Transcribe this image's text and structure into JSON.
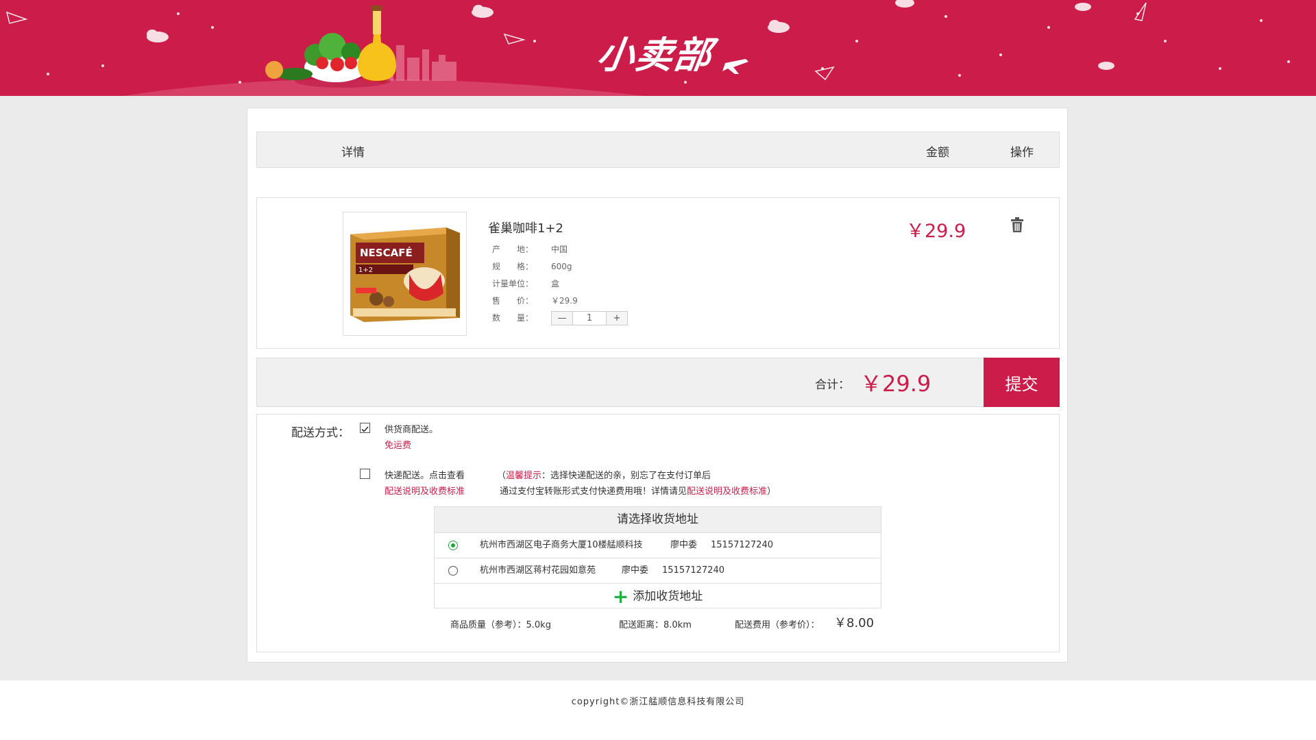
{
  "header": {
    "logo_text": "小卖部"
  },
  "table_header": {
    "detail": "详情",
    "amount": "金额",
    "action": "操作"
  },
  "product": {
    "name": "雀巢咖啡1+2",
    "image_alt": "NESCAFÉ 雀巢咖啡 1+2",
    "attrs": [
      {
        "key": "产　　地：",
        "value": "中国"
      },
      {
        "key": "规　　格：",
        "value": "600g"
      },
      {
        "key": "计量单位：",
        "value": "盒"
      },
      {
        "key": "售　　价：",
        "value": "￥29.9"
      },
      {
        "key": "数　　量："
      }
    ],
    "qty": "1",
    "minus": "—",
    "plus": "+",
    "price": "￥29.9"
  },
  "total": {
    "label": "合计：",
    "value": "￥29.9",
    "submit": "提交"
  },
  "delivery": {
    "label": "配送方式：",
    "option1": {
      "text": "供货商配送。",
      "sub": "免运费",
      "checked": true
    },
    "option2": {
      "text": "快递配送。点击查看",
      "link": "配送说明及收费标准",
      "checked": false
    },
    "tip": {
      "open": "（",
      "tip_label": "温馨提示",
      "line1": "：选择快递配送的亲，别忘了在支付订单后",
      "line2": "通过支付宝转账形式支付快递费用哦！详情请见",
      "link": "配送说明及收费标准",
      "close": "）"
    }
  },
  "address": {
    "title": "请选择收货地址",
    "rows": [
      {
        "addr": "杭州市西湖区电子商务大厦10楼艋顺科技",
        "name": "廖中委",
        "phone": "15157127240",
        "selected": true
      },
      {
        "addr": "杭州市西湖区蒋村花园如意苑",
        "name": "廖中委",
        "phone": "15157127240",
        "selected": false
      }
    ],
    "add_label": "添加收货地址"
  },
  "summary": {
    "weight": "商品质量（参考）：5.0kg",
    "distance": "配送距离：8.0km",
    "fee_label": "配送费用（参考价）：",
    "fee_value": "￥8.00"
  },
  "footer": {
    "copyright": "copyright©浙江艋顺信息科技有限公司"
  },
  "colors": {
    "brand": "#cb1c4a",
    "accent_green": "#1fa63a"
  }
}
